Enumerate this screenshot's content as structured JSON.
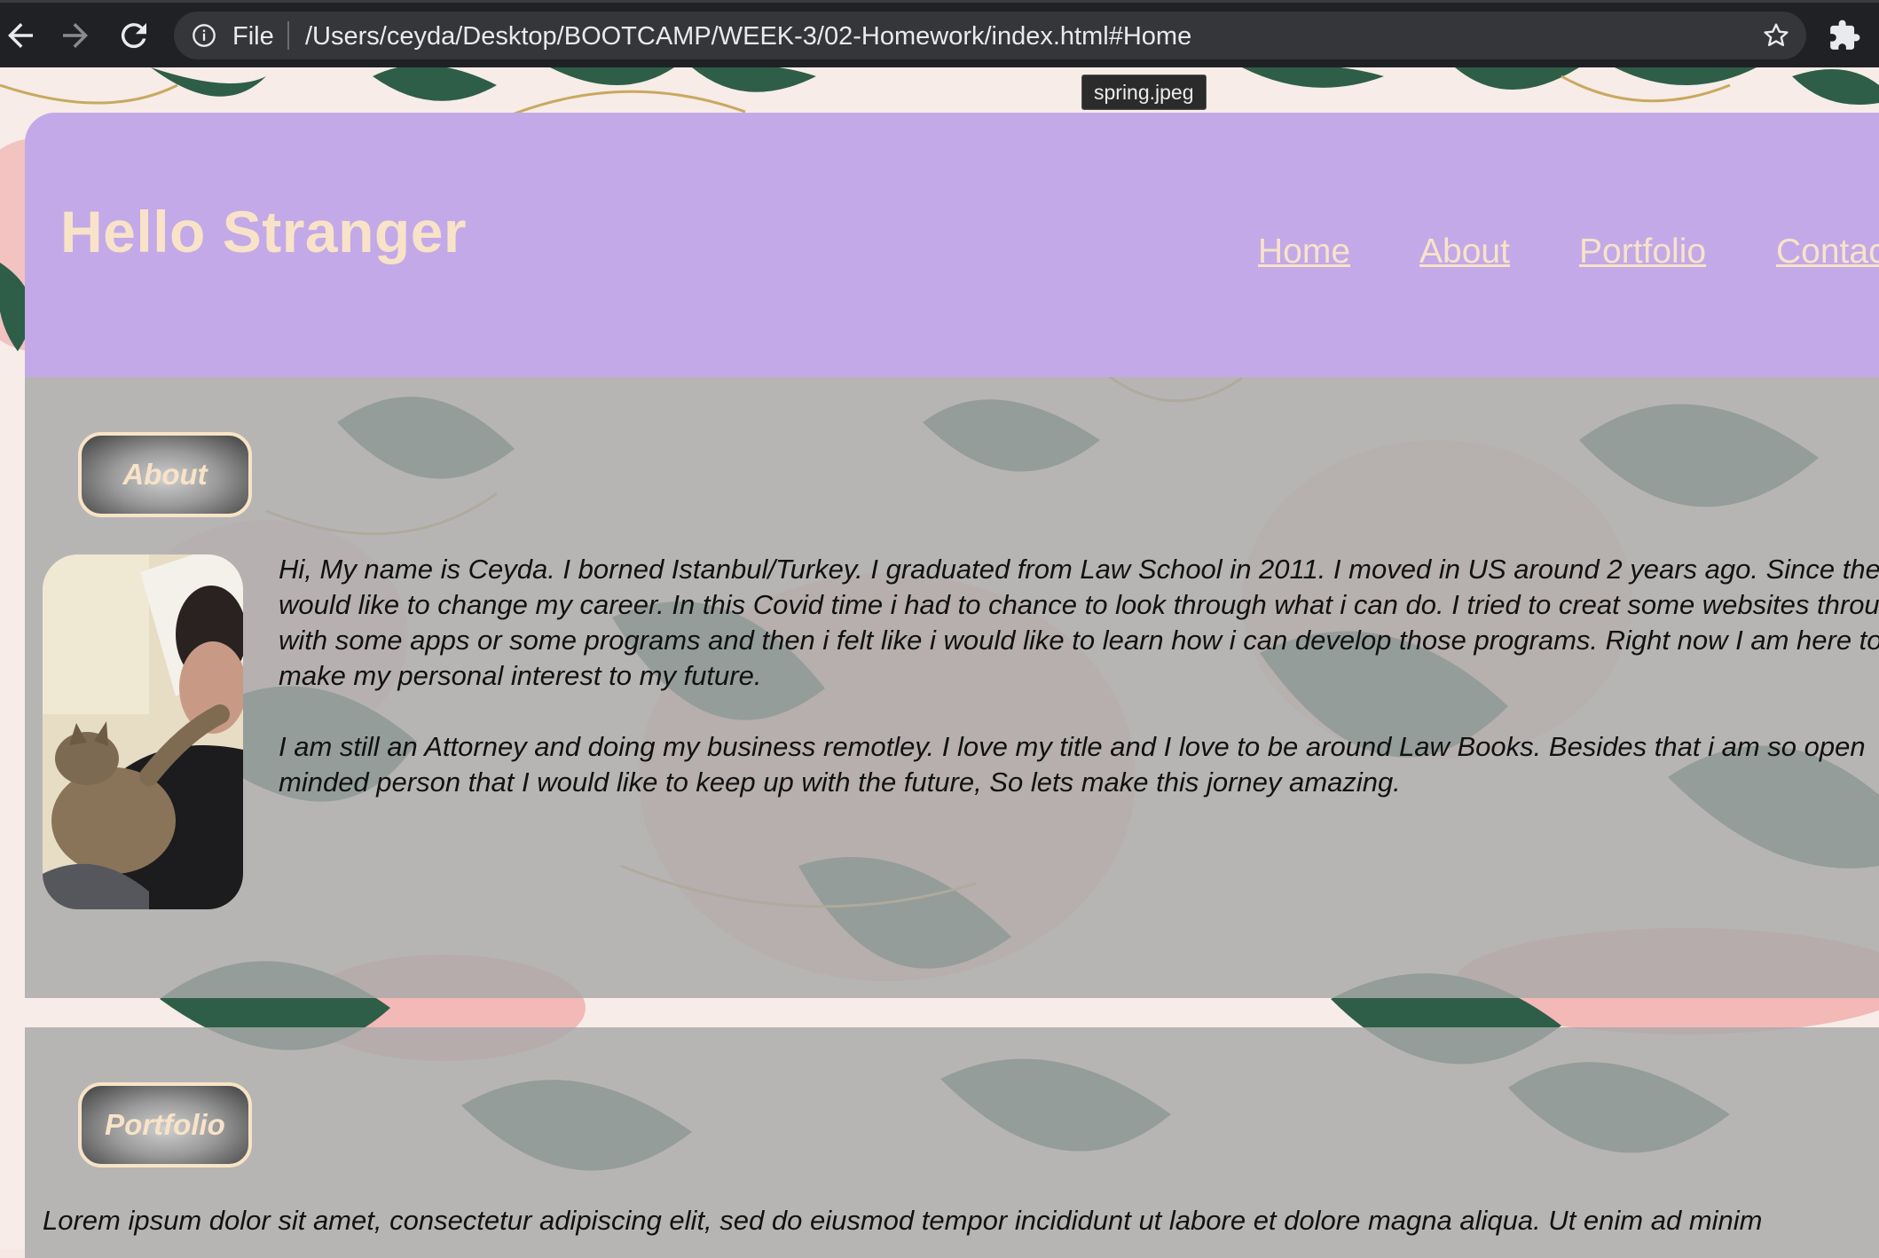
{
  "browser": {
    "scheme_label": "File",
    "url": "/Users/ceyda/Desktop/BOOTCAMP/WEEK-3/02-Homework/index.html#Home",
    "tooltip": "spring.jpeg",
    "icons": [
      "back-arrow-icon",
      "forward-arrow-icon",
      "reload-icon",
      "info-icon",
      "star-icon",
      "puzzle-extension-icon"
    ]
  },
  "header": {
    "title": "Hello Stranger",
    "nav": [
      "Home",
      "About",
      "Portfolio",
      "Contac"
    ]
  },
  "about": {
    "heading": "About",
    "paragraph1": "Hi, My name is Ceyda. I borned Istanbul/Turkey. I graduated from Law School in 2011. I moved in US around 2 years ago. Since then I would like to change my career. In this Covid time i had to chance to look through what i can do. I tried to creat some websites through with some apps or some programs and then i felt like i would like to learn how i can develop those programs. Right now I am here to make my personal interest to my future.",
    "paragraph2": "I am still an Attorney and doing my business remotley. I love my title and I love to be around Law Books. Besides that i am so open minded person that I would like to keep up with the future, So lets make this jorney amazing."
  },
  "portfolio": {
    "heading": "Portfolio",
    "paragraph": "Lorem ipsum dolor sit amet, consectetur adipiscing elit, sed do eiusmod tempor incididunt ut labore et dolore magna aliqua. Ut enim ad minim"
  },
  "colors": {
    "header_bg": "#c4a9e8",
    "header_text": "#f8e3c8",
    "section_overlay": "#aaaaaa",
    "chrome_bg": "#202124"
  }
}
